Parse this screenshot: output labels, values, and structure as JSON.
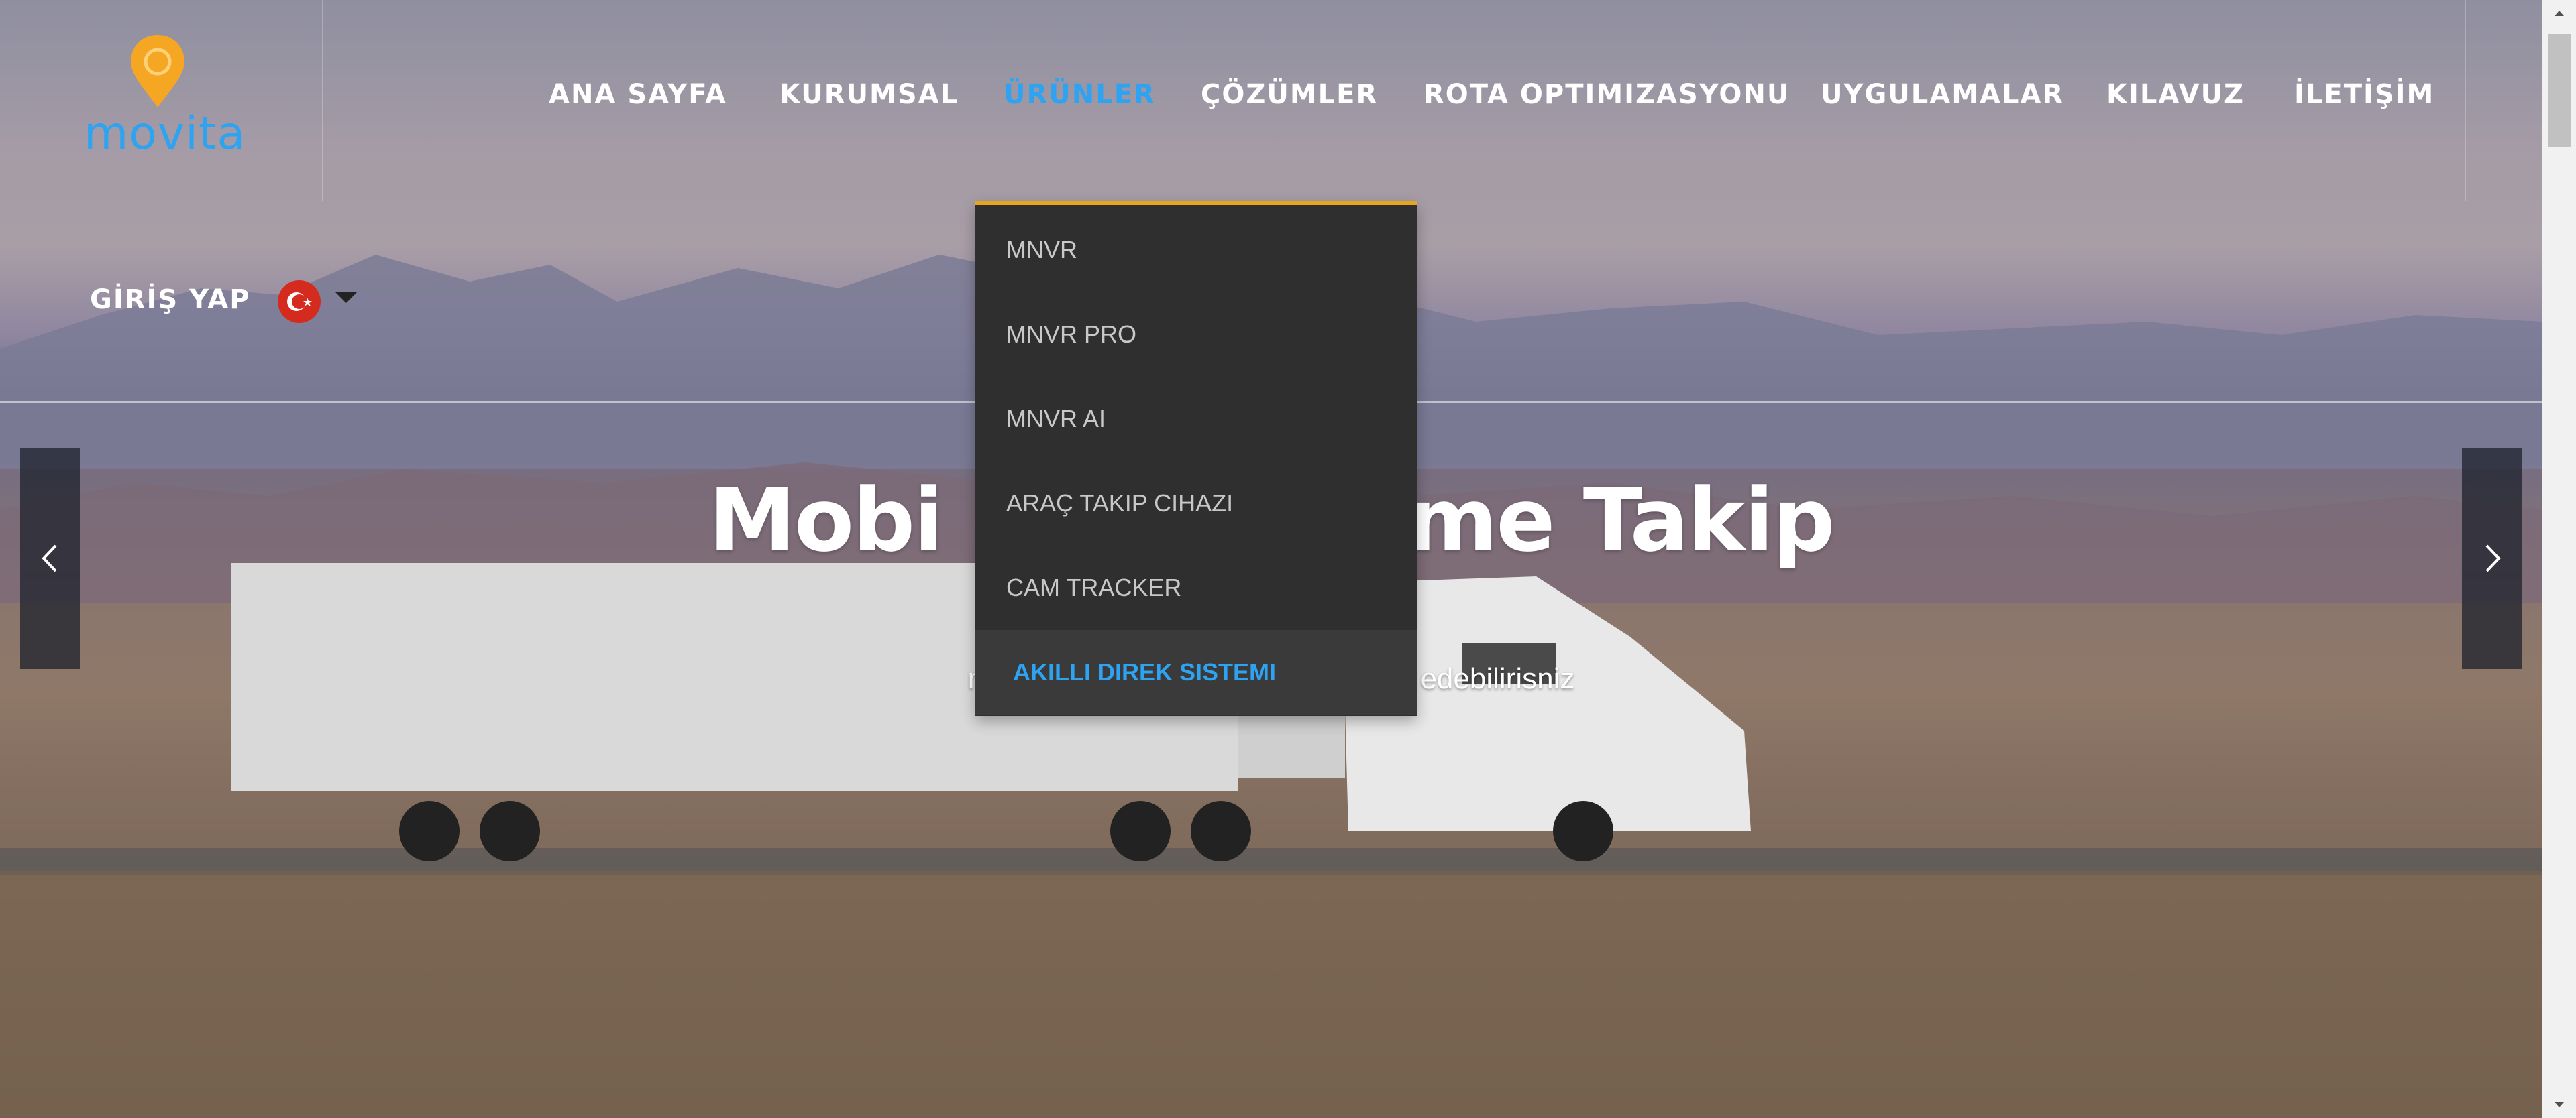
{
  "brand": {
    "name": "movita",
    "logo_color": "#f5a623",
    "text_color": "#2ea3f2"
  },
  "nav": {
    "items": [
      {
        "label": "ANA SAYFA"
      },
      {
        "label": "KURUMSAL"
      },
      {
        "label": "ÜRÜNLER",
        "active": true
      },
      {
        "label": "ÇÖZÜMLER"
      },
      {
        "label": "ROTA OPTIMIZASYONU"
      },
      {
        "label": "UYGULAMALAR"
      },
      {
        "label": "KILAVUZ"
      },
      {
        "label": "İLETİŞİM"
      }
    ],
    "active_color": "#2ea3f2"
  },
  "account": {
    "login_label": "GİRİŞ YAP",
    "language_flag": "turkey-flag-icon"
  },
  "hero": {
    "title": "Mobi                me Takip",
    "subtitle": "movit                                       akip edebilirisniz"
  },
  "dropdown": {
    "accent_color": "#e8a41c",
    "items": [
      {
        "label": "MNVR"
      },
      {
        "label": "MNVR PRO"
      },
      {
        "label": "MNVR AI"
      },
      {
        "label": "ARAÇ TAKIP CIHAZI"
      },
      {
        "label": "CAM TRACKER"
      },
      {
        "label": "AKILLI DIREK SISTEMI",
        "active": true
      }
    ]
  },
  "slider": {
    "prev_icon": "chevron-left-icon",
    "next_icon": "chevron-right-icon"
  }
}
